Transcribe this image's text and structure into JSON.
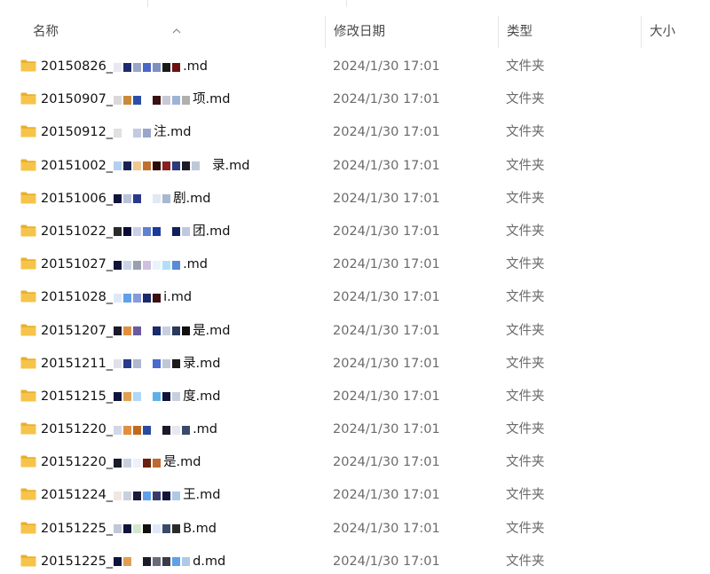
{
  "columns": {
    "name": "名称",
    "date": "修改日期",
    "type": "类型",
    "size": "大小"
  },
  "sort_indicator": "sort-ascending-icon",
  "folder_icon_color": "#f6c44a",
  "rows": [
    {
      "prefix": "20150826_",
      "suffix": ".md",
      "date": "2024/1/30 17:01",
      "type": "文件夹",
      "size": "",
      "redaction": [
        "#e8e8f0",
        "#1d2a6e",
        "#9aa6c9",
        "#4a66c8",
        "#7f8fc0",
        "#1a1a1a",
        "#6d1010"
      ]
    },
    {
      "prefix": "20150907_",
      "suffix": "项.md",
      "date": "2024/1/30 17:01",
      "type": "文件夹",
      "size": "",
      "redaction": [
        "#d9d9d9",
        "#c98a3a",
        "#2b4fa8",
        "#ffffff",
        "#3a1010",
        "#c9c9d6",
        "#9fb4d4",
        "#b0b0b0"
      ]
    },
    {
      "prefix": "20150912_",
      "suffix": "注.md",
      "date": "2024/1/30 17:01",
      "type": "文件夹",
      "size": "",
      "redaction": [
        "#e0e0e0",
        "#ffffff",
        "#c4cbe0",
        "#9aa6c9"
      ]
    },
    {
      "prefix": "20151002_",
      "suffix": "录.md",
      "date": "2024/1/30 17:01",
      "type": "文件夹",
      "size": "",
      "redaction": [
        "#b4d0f0",
        "#1a2350",
        "#f0c890",
        "#c07030",
        "#2a0a0a",
        "#8a2020",
        "#2a3a7a",
        "#1a1a2a",
        "#c0c8d8",
        "#ffffff"
      ]
    },
    {
      "prefix": "20151006_",
      "suffix": "剧.md",
      "date": "2024/1/30 17:01",
      "type": "文件夹",
      "size": "",
      "redaction": [
        "#10143a",
        "#b8c2d8",
        "#2a3a8a",
        "#ffffff",
        "#e0e8f4",
        "#a8b8d0"
      ]
    },
    {
      "prefix": "20151022_",
      "suffix": "团.md",
      "date": "2024/1/30 17:01",
      "type": "文件夹",
      "size": "",
      "redaction": [
        "#2a2a2a",
        "#0a0a3a",
        "#c8d0e8",
        "#6080d0",
        "#1a3a9a",
        "#ffffff",
        "#10205a",
        "#c0c8e0"
      ]
    },
    {
      "prefix": "20151027_",
      "suffix": ".md",
      "date": "2024/1/30 17:01",
      "type": "文件夹",
      "size": "",
      "redaction": [
        "#10143a",
        "#c8d4e8",
        "#9aa0b0",
        "#d0c0e0",
        "#e8f4fc",
        "#b0e0f8",
        "#5a8ad8"
      ]
    },
    {
      "prefix": "20151028_",
      "suffix": "i.md",
      "date": "2024/1/30 17:01",
      "type": "文件夹",
      "size": "",
      "redaction": [
        "#e0e8f8",
        "#60a0e8",
        "#8a9ad8",
        "#1a2a6a",
        "#3a1010"
      ]
    },
    {
      "prefix": "20151207_",
      "suffix": "是.md",
      "date": "2024/1/30 17:01",
      "type": "文件夹",
      "size": "",
      "redaction": [
        "#1a1a2a",
        "#e09040",
        "#6a5aa0",
        "#ffffff",
        "#1a2a6a",
        "#c8d0e0",
        "#2a3a5a",
        "#101010"
      ]
    },
    {
      "prefix": "20151211_",
      "suffix": "录.md",
      "date": "2024/1/30 17:01",
      "type": "文件夹",
      "size": "",
      "redaction": [
        "#e0e0e8",
        "#2a3a8a",
        "#b0b8d0",
        "#ffffff",
        "#4a6ad0",
        "#c0c8d8",
        "#1a1a1a"
      ]
    },
    {
      "prefix": "20151215_",
      "suffix": "度.md",
      "date": "2024/1/30 17:01",
      "type": "文件夹",
      "size": "",
      "redaction": [
        "#10143a",
        "#e0a050",
        "#b0d8f8",
        "#ffffff",
        "#60b0e8",
        "#10143a",
        "#c8d0e0"
      ]
    },
    {
      "prefix": "20151220_",
      "suffix": ".md",
      "date": "2024/1/30 17:01",
      "type": "文件夹",
      "size": "",
      "redaction": [
        "#d0d8e8",
        "#e09040",
        "#c06a20",
        "#2a4aa0",
        "#ffffff",
        "#1a1a2a",
        "#e8e8f0",
        "#3a4a6a"
      ]
    },
    {
      "prefix": "20151220_",
      "suffix": "是.md",
      "date": "2024/1/30 17:01",
      "type": "文件夹",
      "size": "",
      "redaction": [
        "#1a1a2a",
        "#c8d0e0",
        "#f0f0f8",
        "#6a2010",
        "#c06a30"
      ]
    },
    {
      "prefix": "20151224_",
      "suffix": "王.md",
      "date": "2024/1/30 17:01",
      "type": "文件夹",
      "size": "",
      "redaction": [
        "#f0e8e0",
        "#c8d0e0",
        "#1a1a3a",
        "#60a0e8",
        "#3a3a6a",
        "#10143a",
        "#b0c8e8"
      ]
    },
    {
      "prefix": "20151225_",
      "suffix": "B.md",
      "date": "2024/1/30 17:01",
      "type": "文件夹",
      "size": "",
      "redaction": [
        "#c0c8d8",
        "#10143a",
        "#d0e8d0",
        "#101010",
        "#e0e8f8",
        "#3a4a6a",
        "#2a2a2a"
      ]
    },
    {
      "prefix": "20151225_",
      "suffix": "d.md",
      "date": "2024/1/30 17:01",
      "type": "文件夹",
      "size": "",
      "redaction": [
        "#10143a",
        "#e0a050",
        "#ffffff",
        "#1a1a2a",
        "#6a6a7a",
        "#3a3a4a",
        "#60a0e8",
        "#b0c8e8"
      ]
    }
  ]
}
